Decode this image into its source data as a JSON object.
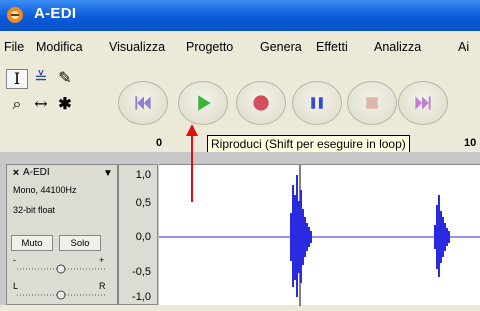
{
  "window": {
    "title": "A-EDI"
  },
  "menu": {
    "items": [
      "File",
      "Modifica",
      "Visualizza",
      "Progetto",
      "Genera",
      "Effetti",
      "Analizza",
      "Ai"
    ]
  },
  "tools": {
    "grid": [
      {
        "name": "selection-tool",
        "glyph": "I"
      },
      {
        "name": "envelope-tool",
        "glyph": "≚"
      },
      {
        "name": "draw-tool",
        "glyph": "✎"
      },
      {
        "name": "zoom-tool",
        "glyph": "⌕"
      },
      {
        "name": "timeshift-tool",
        "glyph": "↔"
      },
      {
        "name": "multi-tool",
        "glyph": "✱"
      }
    ],
    "transport": [
      "skip-start",
      "play",
      "record",
      "pause",
      "stop",
      "skip-end"
    ]
  },
  "ruler": {
    "ticks": [
      "0",
      "10"
    ]
  },
  "tooltip": {
    "text": "Riproduci (Shift per eseguire in loop)"
  },
  "track": {
    "name": "A-EDI",
    "close_glyph": "×",
    "dropdown_glyph": "▼",
    "rate": "Mono, 44100Hz",
    "format": "32-bit float",
    "mute_label": "Muto",
    "solo_label": "Solo",
    "gain_minus": "-",
    "gain_plus": "+",
    "pan_left": "L",
    "pan_right": "R"
  },
  "scale": {
    "labels": [
      "1,0",
      "0,5",
      "0,0",
      "-0,5",
      "-1,0"
    ]
  },
  "colors": {
    "waveform": "#2a2ae0",
    "arrow": "#e01010",
    "title_bar": "#0a5ad8",
    "tooltip_bg": "#ffffe1"
  }
}
